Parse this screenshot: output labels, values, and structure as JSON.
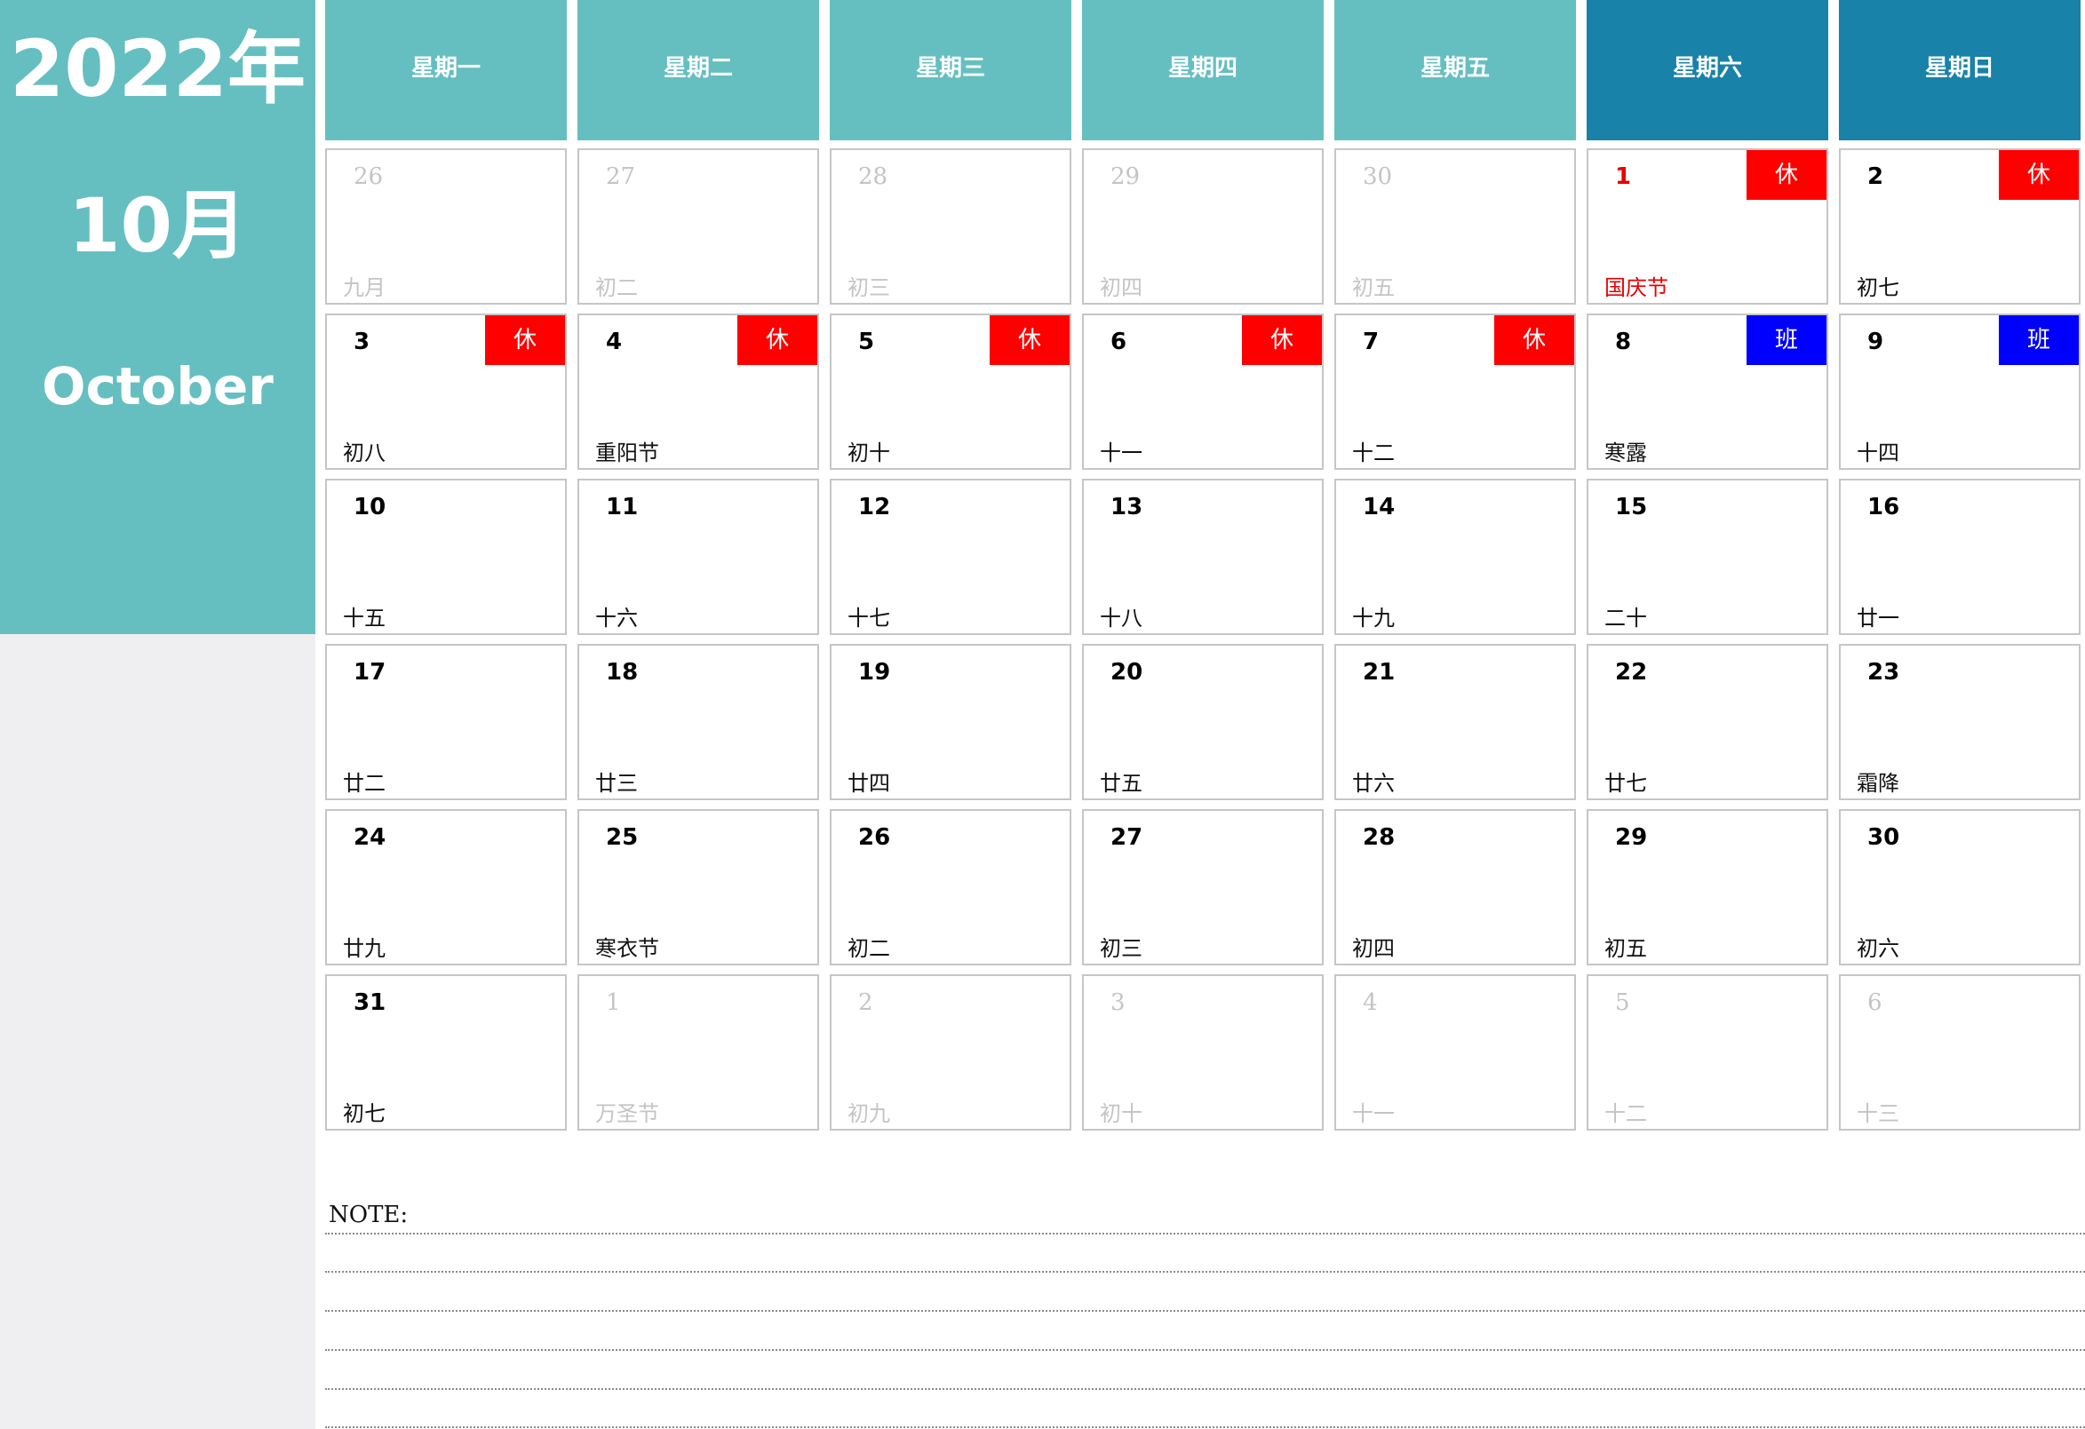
{
  "sidebar": {
    "year": "2022年",
    "month": "10月",
    "month_en": "October"
  },
  "weekdays": [
    "星期一",
    "星期二",
    "星期三",
    "星期四",
    "星期五",
    "星期六",
    "星期日"
  ],
  "weeks": [
    [
      {
        "day": "26",
        "lunar": "九月",
        "other": true
      },
      {
        "day": "27",
        "lunar": "初二",
        "other": true
      },
      {
        "day": "28",
        "lunar": "初三",
        "other": true
      },
      {
        "day": "29",
        "lunar": "初四",
        "other": true
      },
      {
        "day": "30",
        "lunar": "初五",
        "other": true
      },
      {
        "day": "1",
        "lunar": "国庆节",
        "tag": "休",
        "tag_type": "rest",
        "holiday": true
      },
      {
        "day": "2",
        "lunar": "初七",
        "tag": "休",
        "tag_type": "rest"
      }
    ],
    [
      {
        "day": "3",
        "lunar": "初八",
        "tag": "休",
        "tag_type": "rest"
      },
      {
        "day": "4",
        "lunar": "重阳节",
        "tag": "休",
        "tag_type": "rest"
      },
      {
        "day": "5",
        "lunar": "初十",
        "tag": "休",
        "tag_type": "rest"
      },
      {
        "day": "6",
        "lunar": "十一",
        "tag": "休",
        "tag_type": "rest"
      },
      {
        "day": "7",
        "lunar": "十二",
        "tag": "休",
        "tag_type": "rest"
      },
      {
        "day": "8",
        "lunar": "寒露",
        "tag": "班",
        "tag_type": "work"
      },
      {
        "day": "9",
        "lunar": "十四",
        "tag": "班",
        "tag_type": "work"
      }
    ],
    [
      {
        "day": "10",
        "lunar": "十五"
      },
      {
        "day": "11",
        "lunar": "十六"
      },
      {
        "day": "12",
        "lunar": "十七"
      },
      {
        "day": "13",
        "lunar": "十八"
      },
      {
        "day": "14",
        "lunar": "十九"
      },
      {
        "day": "15",
        "lunar": "二十"
      },
      {
        "day": "16",
        "lunar": "廿一"
      }
    ],
    [
      {
        "day": "17",
        "lunar": "廿二"
      },
      {
        "day": "18",
        "lunar": "廿三"
      },
      {
        "day": "19",
        "lunar": "廿四"
      },
      {
        "day": "20",
        "lunar": "廿五"
      },
      {
        "day": "21",
        "lunar": "廿六"
      },
      {
        "day": "22",
        "lunar": "廿七"
      },
      {
        "day": "23",
        "lunar": "霜降"
      }
    ],
    [
      {
        "day": "24",
        "lunar": "廿九"
      },
      {
        "day": "25",
        "lunar": "寒衣节"
      },
      {
        "day": "26",
        "lunar": "初二"
      },
      {
        "day": "27",
        "lunar": "初三"
      },
      {
        "day": "28",
        "lunar": "初四"
      },
      {
        "day": "29",
        "lunar": "初五"
      },
      {
        "day": "30",
        "lunar": "初六"
      }
    ],
    [
      {
        "day": "31",
        "lunar": "初七"
      },
      {
        "day": "1",
        "lunar": "万圣节",
        "other": true
      },
      {
        "day": "2",
        "lunar": "初九",
        "other": true
      },
      {
        "day": "3",
        "lunar": "初十",
        "other": true
      },
      {
        "day": "4",
        "lunar": "十一",
        "other": true
      },
      {
        "day": "5",
        "lunar": "十二",
        "other": true
      },
      {
        "day": "6",
        "lunar": "十三",
        "other": true
      }
    ]
  ],
  "note": {
    "label": "NOTE:"
  },
  "colors": {
    "teal": "#65bfc1",
    "weekend_header": "#1882a8",
    "rest_tag": "#ff0000",
    "work_tag": "#0000ff",
    "holiday_text": "#e60000"
  }
}
